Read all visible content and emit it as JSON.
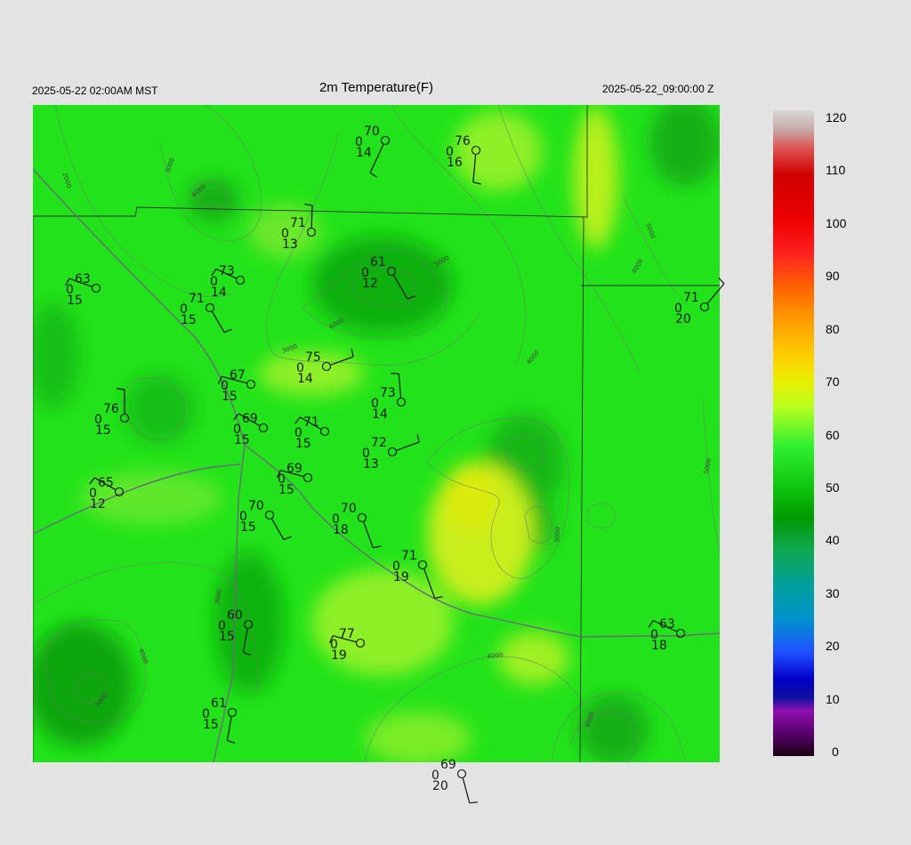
{
  "header": {
    "local_time": "2025-05-22 02:00AM MST",
    "title": "2m Temperature(F)",
    "utc_time": "2025-05-22_09:00:00 Z"
  },
  "colorbar": {
    "ticks": [
      "120",
      "110",
      "100",
      "90",
      "80",
      "70",
      "60",
      "50",
      "40",
      "30",
      "20",
      "10",
      "0"
    ]
  },
  "contour_labels": [
    "2000",
    "3000",
    "4000",
    "5000",
    "6000",
    "3000",
    "4000",
    "5000",
    "4000",
    "5000",
    "4000",
    "5000",
    "6000",
    "3000",
    "4000",
    "5000"
  ],
  "stations": [
    {
      "t": "70",
      "z": "0",
      "d": "14"
    },
    {
      "t": "76",
      "z": "0",
      "d": "16"
    },
    {
      "t": "71",
      "z": "0",
      "d": "13"
    },
    {
      "t": "73",
      "z": "0",
      "d": "14"
    },
    {
      "t": "61",
      "z": "0",
      "d": "12"
    },
    {
      "t": "63",
      "z": "0",
      "d": "15"
    },
    {
      "t": "71",
      "z": "0",
      "d": "15"
    },
    {
      "t": "71",
      "z": "0",
      "d": "20"
    },
    {
      "t": "75",
      "z": "0",
      "d": "14"
    },
    {
      "t": "67",
      "z": "0",
      "d": "15"
    },
    {
      "t": "73",
      "z": "0",
      "d": "14"
    },
    {
      "t": "76",
      "z": "0",
      "d": "15"
    },
    {
      "t": "69",
      "z": "0",
      "d": "15"
    },
    {
      "t": "71",
      "z": "0",
      "d": "15"
    },
    {
      "t": "72",
      "z": "0",
      "d": "13"
    },
    {
      "t": "69",
      "z": "0",
      "d": "15"
    },
    {
      "t": "65",
      "z": "0",
      "d": "12"
    },
    {
      "t": "70",
      "z": "0",
      "d": "15"
    },
    {
      "t": "70",
      "z": "0",
      "d": "18"
    },
    {
      "t": "71",
      "z": "0",
      "d": "19"
    },
    {
      "t": "60",
      "z": "0",
      "d": "15"
    },
    {
      "t": "63",
      "z": "0",
      "d": "18"
    },
    {
      "t": "77",
      "z": "0",
      "d": "19"
    },
    {
      "t": "61",
      "z": "0",
      "d": "15"
    },
    {
      "t": "69",
      "z": "0",
      "d": "20"
    }
  ]
}
